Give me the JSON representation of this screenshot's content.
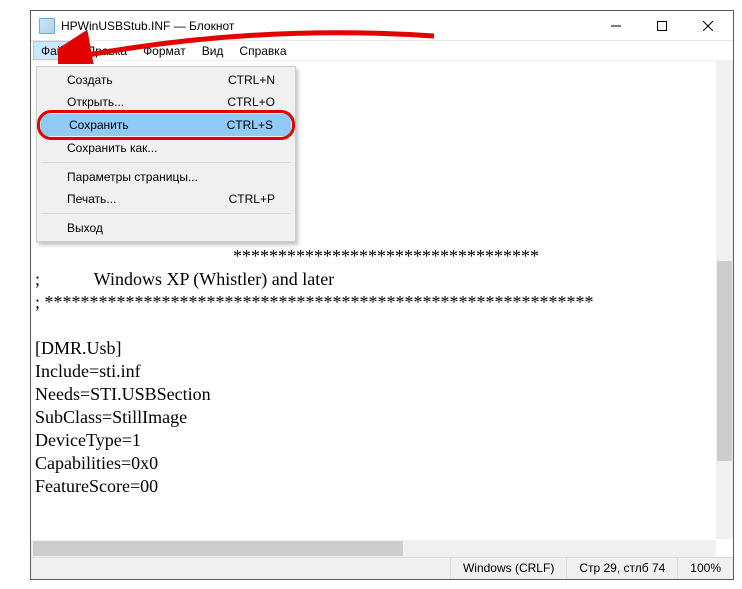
{
  "window": {
    "title": "HPWinUSBStub.INF — Блокнот"
  },
  "menubar": {
    "items": [
      {
        "label": "Файл",
        "open": true
      },
      {
        "label": "Правка"
      },
      {
        "label": "Формат"
      },
      {
        "label": "Вид"
      },
      {
        "label": "Справка"
      }
    ]
  },
  "file_menu": {
    "new": {
      "label": "Создать",
      "shortcut": "CTRL+N"
    },
    "open": {
      "label": "Открыть...",
      "shortcut": "CTRL+O"
    },
    "save": {
      "label": "Сохранить",
      "shortcut": "CTRL+S"
    },
    "saveas": {
      "label": "Сохранить как...",
      "shortcut": ""
    },
    "pagesetup": {
      "label": "Параметры страницы...",
      "shortcut": ""
    },
    "print": {
      "label": "Печать...",
      "shortcut": "CTRL+P"
    },
    "exit": {
      "label": "Выход",
      "shortcut": ""
    }
  },
  "editor": {
    "lines": [
      "",
      "",
      "",
      "",
      "",
      "",
      "",
      "",
      "                                            **********************************",
      ";            Windows XP (Whistler) and later",
      "; *************************************************************",
      "",
      "[DMR.Usb]",
      "Include=sti.inf",
      "Needs=STI.USBSection",
      "SubClass=StillImage",
      "DeviceType=1",
      "Capabilities=0x0",
      "FeatureScore=00"
    ]
  },
  "status": {
    "encoding": "Windows (CRLF)",
    "position": "Стр 29, стлб 74",
    "zoom": "100%"
  }
}
